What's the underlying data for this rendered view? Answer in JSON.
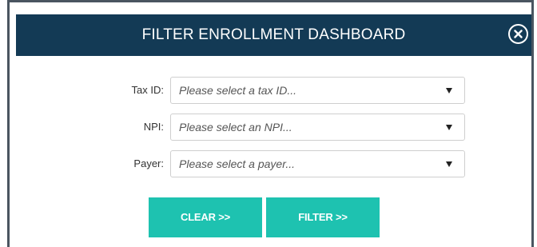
{
  "modal": {
    "title": "FILTER ENROLLMENT DASHBOARD",
    "close_icon": "close-circle-icon",
    "header_color": "#133a55"
  },
  "filters": {
    "tax_id": {
      "label": "Tax ID:",
      "placeholder": "Please select a tax ID..."
    },
    "npi": {
      "label": "NPI:",
      "placeholder": "Please select an NPI..."
    },
    "payer": {
      "label": "Payer:",
      "placeholder": "Please select a payer..."
    }
  },
  "actions": {
    "clear_label": "CLEAR >>",
    "filter_label": "FILTER >>",
    "button_color": "#1ec2b0"
  }
}
